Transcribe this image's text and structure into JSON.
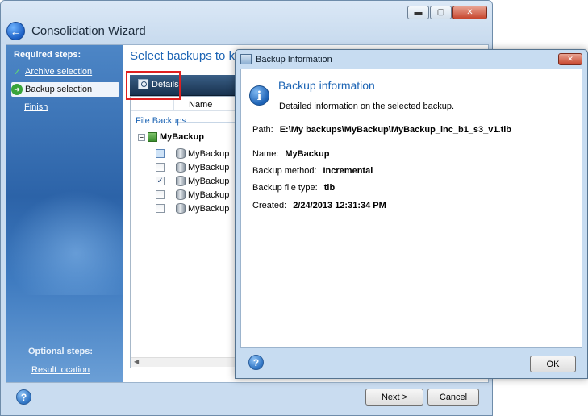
{
  "wizard": {
    "title": "Consolidation Wizard",
    "window_controls": {
      "minimize": "▬",
      "maximize": "▢",
      "close": "✕"
    },
    "back_glyph": "←",
    "steps_header": "Required steps:",
    "steps": [
      {
        "label": "Archive selection",
        "status": "done",
        "icon": "checkmark-icon",
        "glyph": "✓"
      },
      {
        "label": "Backup selection",
        "status": "current",
        "icon": "arrow-right-icon",
        "glyph": "➜"
      },
      {
        "label": "Finish",
        "status": "pending"
      }
    ],
    "optional_header": "Optional steps:",
    "optional_steps": [
      {
        "label": "Result location"
      }
    ],
    "page_title": "Select backups to ke",
    "toolbar": {
      "details_label": "Details"
    },
    "list": {
      "columns": [
        "Name"
      ],
      "group_label": "File Backups",
      "root": {
        "label": "MyBackup",
        "expander": "−"
      },
      "rows": [
        {
          "name": "MyBackup",
          "checked": "partial",
          "mark": ""
        },
        {
          "name": "MyBackup",
          "checked": false,
          "mark": ""
        },
        {
          "name": "MyBackup",
          "checked": true,
          "mark": "✓"
        },
        {
          "name": "MyBackup",
          "checked": false,
          "mark": ""
        },
        {
          "name": "MyBackup",
          "checked": false,
          "mark": ""
        }
      ],
      "scroll_arrow": "◀"
    },
    "footer": {
      "help_glyph": "?",
      "next_label": "Next >",
      "cancel_label": "Cancel"
    }
  },
  "dialog": {
    "title": "Backup Information",
    "close_glyph": "✕",
    "info_glyph": "i",
    "heading": "Backup information",
    "subheading": "Detailed information on the selected backup.",
    "fields": {
      "path": {
        "label": "Path:",
        "value": "E:\\My backups\\MyBackup\\MyBackup_inc_b1_s3_v1.tib"
      },
      "name": {
        "label": "Name:",
        "value": "MyBackup"
      },
      "method": {
        "label": "Backup method:",
        "value": "Incremental"
      },
      "filetype": {
        "label": "Backup file type:",
        "value": "tib"
      },
      "created": {
        "label": "Created:",
        "value": "2/24/2013 12:31:34 PM"
      }
    },
    "ok_label": "OK",
    "help_glyph": "?"
  },
  "colors": {
    "accent_blue": "#1c64b4",
    "steps_panel": "#2c63a8",
    "highlight_red": "#e02020"
  }
}
